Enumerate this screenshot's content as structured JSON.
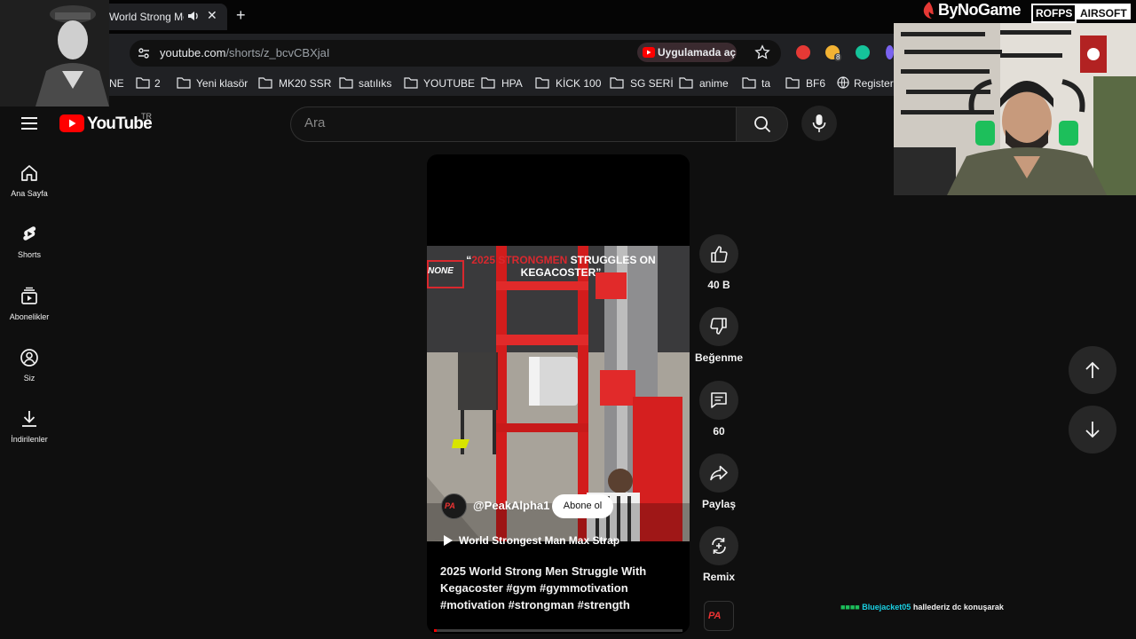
{
  "browser": {
    "tab_title": "World Strong Men",
    "url_host": "youtube.com",
    "url_path": "/shorts/z_bcvCBXjaI",
    "open_in_app": "Uygulamada aç",
    "extension_badge": "8",
    "bookmarks": [
      "NE",
      "2",
      "Yeni klasör",
      "MK20 SSR",
      "satılıks",
      "YOUTUBE",
      "HPA",
      "KİCK 100",
      "SG SERİ",
      "anime",
      "ta",
      "BF6",
      "Register"
    ]
  },
  "youtube": {
    "logo_text": "YouTube",
    "region": "TR",
    "search_placeholder": "Ara"
  },
  "sidebar": {
    "items": [
      {
        "label": "Ana Sayfa",
        "icon": "home-icon"
      },
      {
        "label": "Shorts",
        "icon": "shorts-icon"
      },
      {
        "label": "Abonelikler",
        "icon": "subscriptions-icon"
      },
      {
        "label": "Siz",
        "icon": "account-icon"
      },
      {
        "label": "İndirilenler",
        "icon": "download-icon"
      }
    ]
  },
  "short": {
    "overlay_red": "2025 STRONGMEN",
    "overlay_white": "STRUGGLES ON KEGACOSTER",
    "overlay_badge": "NONE",
    "channel_handle": "@PeakAlpha1",
    "channel_initials": "PA",
    "subscribe_label": "Abone ol",
    "playlist": "World Strongest Man Max Strap",
    "description": "2025 World Strong Men Struggle With Kegacoster #gym #gymmotivation #motivation #strongman #strength",
    "progress": 0.01
  },
  "actions": {
    "like_count": "40 B",
    "dislike_label": "Beğenme",
    "comment_count": "60",
    "share_label": "Paylaş",
    "remix_label": "Remix"
  },
  "stream": {
    "brand_left": "ByNoGame",
    "brand_right_1": "ROFPS",
    "brand_right_2": "AIRSOFT",
    "chat_user": "Bluejacket05",
    "chat_message": "hallederiz dc konuşarak"
  },
  "colors": {
    "accent": "#ff0000",
    "background": "#0f0f0f"
  }
}
